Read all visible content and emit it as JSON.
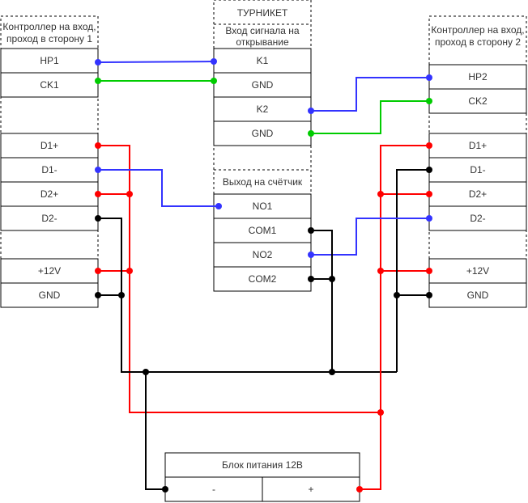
{
  "colors": {
    "blue": "#3333ff",
    "green": "#00cc00",
    "red": "#ff0000",
    "black": "#000000"
  },
  "controller1": {
    "title_line1": "Контроллер на вход,",
    "title_line2": "проход в сторону 1",
    "pins": [
      "HP1",
      "CK1",
      "D1+",
      "D1-",
      "D2+",
      "D2-",
      "+12V",
      "GND"
    ]
  },
  "turnstile": {
    "title": "ТУРНИКЕТ",
    "input_title_line1": "Вход сигнала на",
    "input_title_line2": "открывание",
    "input_pins": [
      "K1",
      "GND",
      "K2",
      "GND"
    ],
    "output_title": "Выход на счётчик",
    "output_pins": [
      "NO1",
      "COM1",
      "NO2",
      "COM2"
    ]
  },
  "controller2": {
    "title_line1": "Контроллер на вход,",
    "title_line2": "проход в сторону 2",
    "pins": [
      "HP2",
      "CK2",
      "D1+",
      "D1-",
      "D2+",
      "D2-",
      "+12V",
      "GND"
    ]
  },
  "power_supply": {
    "title": "Блок питания 12В",
    "minus": "-",
    "plus": "+"
  }
}
